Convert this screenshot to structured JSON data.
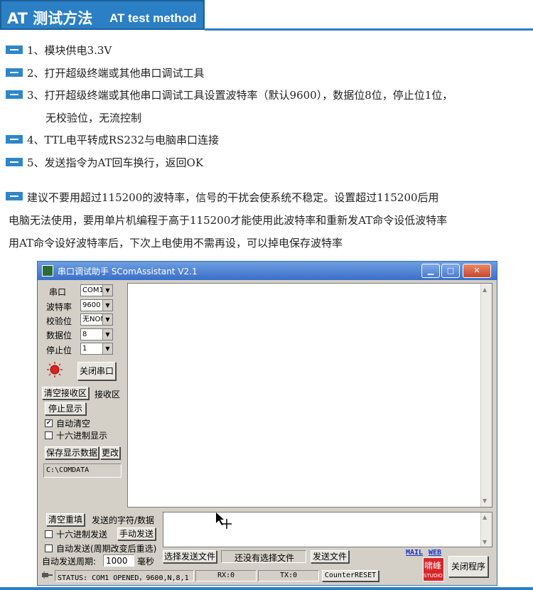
{
  "header": {
    "title_cn": "AT 测试方法",
    "title_en": "AT test method"
  },
  "steps": [
    "1、模块供电3.3V",
    "2、打开超级终端或其他串口调试工具",
    "3、打开超级终端或其他串口调试工具设置波特率（默认9600），数据位8位，停止位1位，",
    "无校验位，无流控制",
    "4、TTL电平转成RS232与电脑串口连接",
    "5、发送指令为AT回车换行，返回OK"
  ],
  "note": [
    "建议不要用超过115200的波特率，信号的干扰会使系统不稳定。设置超过115200后用",
    "电脑无法使用，要用单片机编程于高于115200才能使用此波特率和重新发AT命令设低波特率",
    "用AT命令设好波特率后，下次上电使用不需再设，可以掉电保存波特率"
  ],
  "window": {
    "title": "串口调试助手 SComAssistant V2.1",
    "controls": {
      "minimize": "▁",
      "maximize": "□",
      "close": "✕"
    },
    "settings": {
      "port_label": "串口",
      "port_value": "COM1",
      "baud_label": "波特率",
      "baud_value": "9600",
      "parity_label": "校验位",
      "parity_value": "无NON",
      "data_label": "数据位",
      "data_value": "8",
      "stop_label": "停止位",
      "stop_value": "1"
    },
    "close_port_button": "关闭串口",
    "clear_receive_button": "清空接收区",
    "receive_area_label": "接收区",
    "stop_display_button": "停止显示",
    "auto_clear_label": "自动清空",
    "auto_clear_checked": true,
    "hex_display_label": "十六进制显示",
    "save_display_button": "保存显示数据",
    "change_button": "更改",
    "save_path": "C:\\COMDATA",
    "clear_resend_button": "清空重填",
    "send_chars_label": "发送的字符/数据",
    "hex_send_label": "十六进制发送",
    "manual_send_button": "手动发送",
    "auto_send_label": "自动发送(周期改变后重选)",
    "auto_send_period_label": "自动发送周期:",
    "auto_send_period_value": "1000",
    "ms_label": "毫秒",
    "select_file_button": "选择发送文件",
    "no_file_label": "还没有选择文件",
    "send_file_button": "发送文件",
    "mail_link": "MAIL",
    "web_link": "WEB",
    "logo_text": "啸峰",
    "logo_sub": "STUDIO",
    "close_program_button": "关闭程序",
    "status_text": "STATUS: COM1 OPENED，9600,N,8,1",
    "rx_text": "RX:0",
    "tx_text": "TX:0",
    "counter_reset_button": "CounterRESET"
  }
}
